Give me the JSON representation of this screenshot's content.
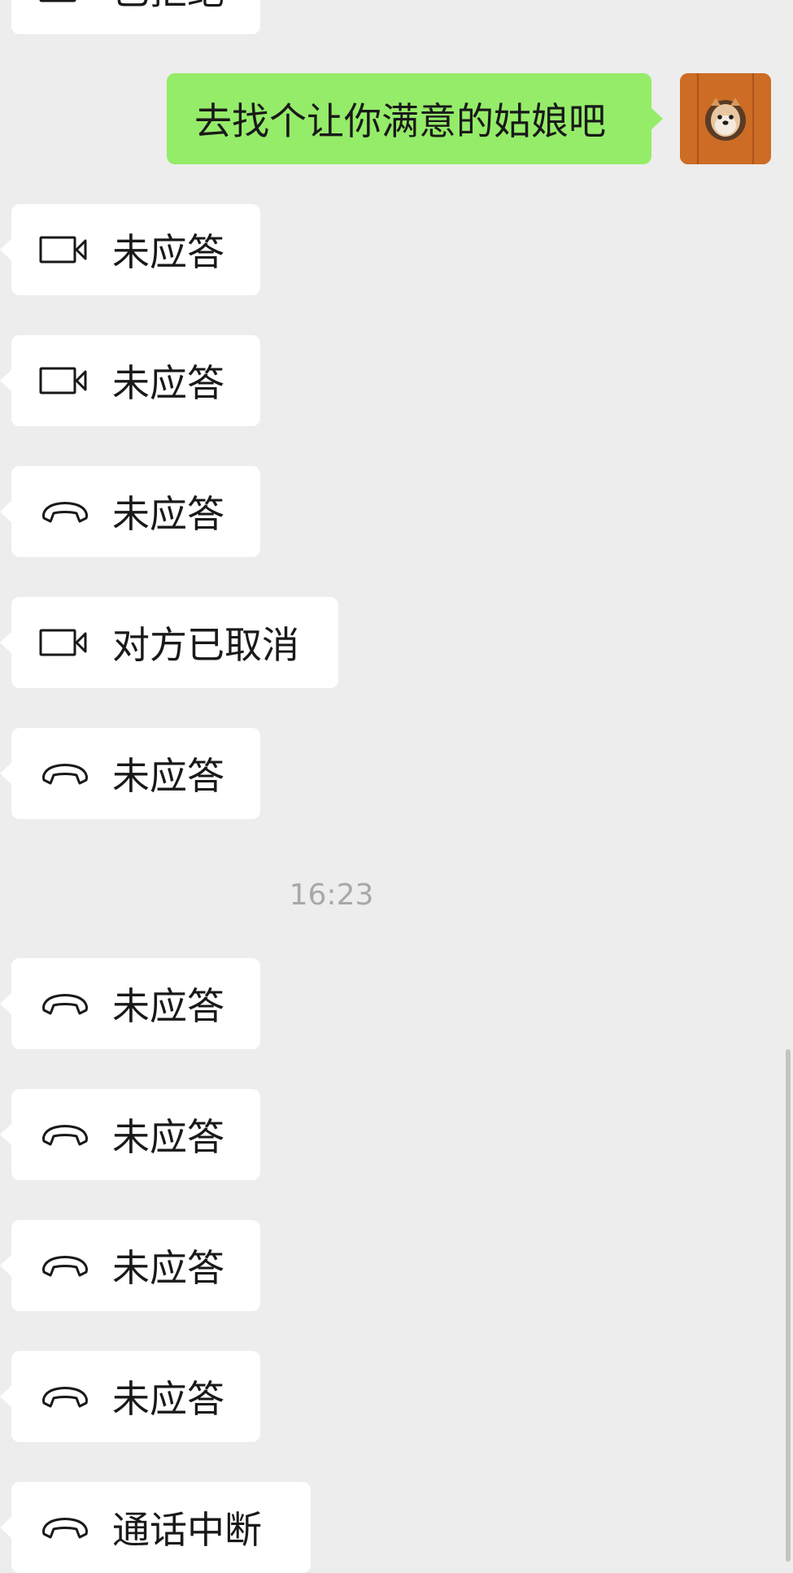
{
  "chat": {
    "top_partial": {
      "text": "已拒绝",
      "icon": "video-call-icon"
    },
    "outgoing_message": {
      "text": "去找个让你满意的姑娘吧",
      "avatar": "shiba-dog-avatar"
    },
    "calls_before": [
      {
        "icon": "video-call-icon",
        "status": "未应答"
      },
      {
        "icon": "video-call-icon",
        "status": "未应答"
      },
      {
        "icon": "voice-call-icon",
        "status": "未应答"
      },
      {
        "icon": "video-call-icon",
        "status": "对方已取消"
      },
      {
        "icon": "voice-call-icon",
        "status": "未应答"
      }
    ],
    "timestamp": "16:23",
    "calls_after": [
      {
        "icon": "voice-call-icon",
        "status": "未应答"
      },
      {
        "icon": "voice-call-icon",
        "status": "未应答"
      },
      {
        "icon": "voice-call-icon",
        "status": "未应答"
      },
      {
        "icon": "voice-call-icon",
        "status": "未应答"
      },
      {
        "icon": "voice-call-icon",
        "status": "通话中断"
      }
    ]
  },
  "colors": {
    "background": "#ededed",
    "outgoing_bubble": "#95ec69",
    "incoming_bubble": "#ffffff",
    "timestamp_text": "#a8a8a8"
  }
}
